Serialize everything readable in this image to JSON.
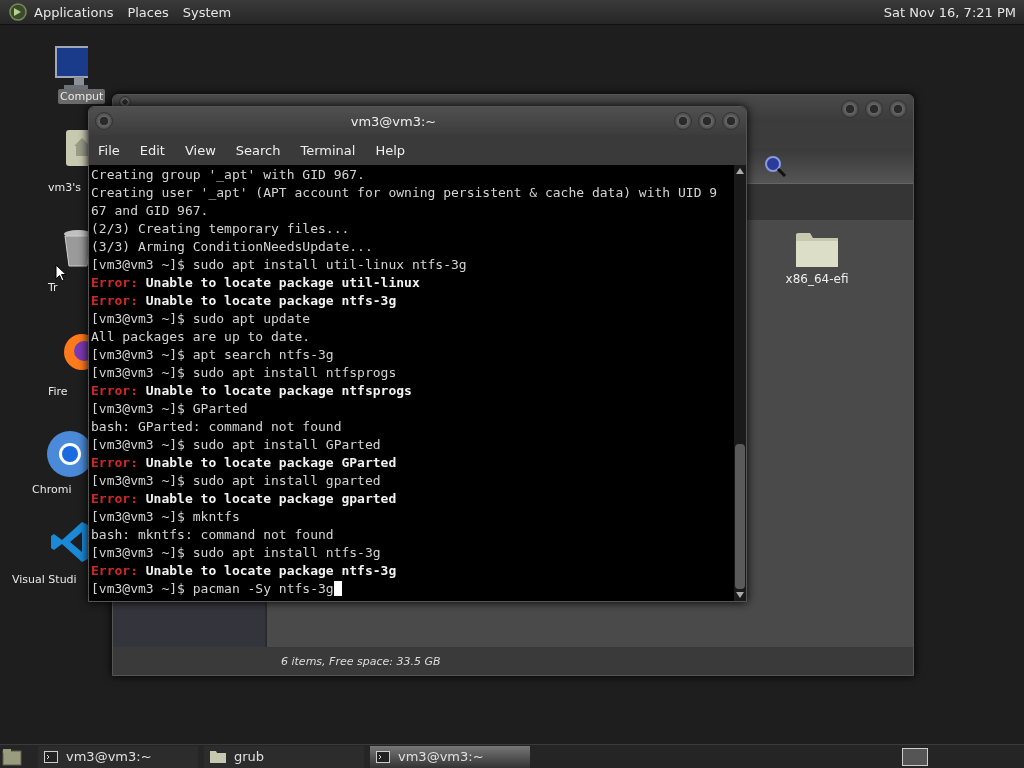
{
  "top_panel": {
    "menus": [
      "Applications",
      "Places",
      "System"
    ],
    "clock": "Sat Nov 16, 7:21 PM"
  },
  "desktop_icons": [
    {
      "kind": "computer",
      "label": "Comput",
      "selected": true
    },
    {
      "kind": "home",
      "label": "vm3's",
      "selected": false
    },
    {
      "kind": "trash",
      "label": "Tr",
      "selected": false
    },
    {
      "kind": "firefox",
      "label": "Fire",
      "selected": false
    },
    {
      "kind": "chromium",
      "label": "Chromi",
      "selected": false
    },
    {
      "kind": "vscode",
      "label": "Visual Studi",
      "selected": false
    }
  ],
  "file_manager": {
    "files": [
      {
        "name": "x86_64-efi"
      }
    ],
    "status": "6 items, Free space: 33.5 GB"
  },
  "terminal": {
    "title": "vm3@vm3:~",
    "menus": [
      "File",
      "Edit",
      "View",
      "Search",
      "Terminal",
      "Help"
    ],
    "lines": [
      {
        "kind": "output",
        "text": "Creating group '_apt' with GID 967."
      },
      {
        "kind": "output",
        "text": "Creating user '_apt' (APT account for owning persistent & cache data) with UID 9"
      },
      {
        "kind": "output",
        "text": "67 and GID 967."
      },
      {
        "kind": "output",
        "text": "(2/3) Creating temporary files..."
      },
      {
        "kind": "output",
        "text": "(3/3) Arming ConditionNeedsUpdate..."
      },
      {
        "kind": "output",
        "text": "[vm3@vm3 ~]$ sudo apt install util-linux ntfs-3g"
      },
      {
        "kind": "error",
        "label": "Error:",
        "text": "Unable to locate package util-linux"
      },
      {
        "kind": "error",
        "label": "Error:",
        "text": "Unable to locate package ntfs-3g"
      },
      {
        "kind": "output",
        "text": "[vm3@vm3 ~]$ sudo apt update"
      },
      {
        "kind": "output",
        "text": "All packages are up to date."
      },
      {
        "kind": "output",
        "text": "[vm3@vm3 ~]$ apt search ntfs-3g"
      },
      {
        "kind": "output",
        "text": "[vm3@vm3 ~]$ sudo apt install ntfsprogs"
      },
      {
        "kind": "error",
        "label": "Error:",
        "text": "Unable to locate package ntfsprogs"
      },
      {
        "kind": "output",
        "text": "[vm3@vm3 ~]$ GParted"
      },
      {
        "kind": "output",
        "text": "bash: GParted: command not found"
      },
      {
        "kind": "output",
        "text": "[vm3@vm3 ~]$ sudo apt install GParted"
      },
      {
        "kind": "error",
        "label": "Error:",
        "text": "Unable to locate package GParted"
      },
      {
        "kind": "output",
        "text": "[vm3@vm3 ~]$ sudo apt install gparted"
      },
      {
        "kind": "error",
        "label": "Error:",
        "text": "Unable to locate package gparted"
      },
      {
        "kind": "output",
        "text": "[vm3@vm3 ~]$ mkntfs"
      },
      {
        "kind": "output",
        "text": "bash: mkntfs: command not found"
      },
      {
        "kind": "output",
        "text": "[vm3@vm3 ~]$ sudo apt install ntfs-3g"
      },
      {
        "kind": "error",
        "label": "Error:",
        "text": "Unable to locate package ntfs-3g"
      },
      {
        "kind": "output",
        "text": "[vm3@vm3 ~]$ pacman -Sy ntfs-3g"
      }
    ]
  },
  "taskbar": {
    "tasks": [
      {
        "kind": "terminal",
        "label": "vm3@vm3:~",
        "selected": false
      },
      {
        "kind": "folder",
        "label": "grub",
        "selected": false
      },
      {
        "kind": "terminal",
        "label": "vm3@vm3:~",
        "selected": true
      }
    ]
  }
}
